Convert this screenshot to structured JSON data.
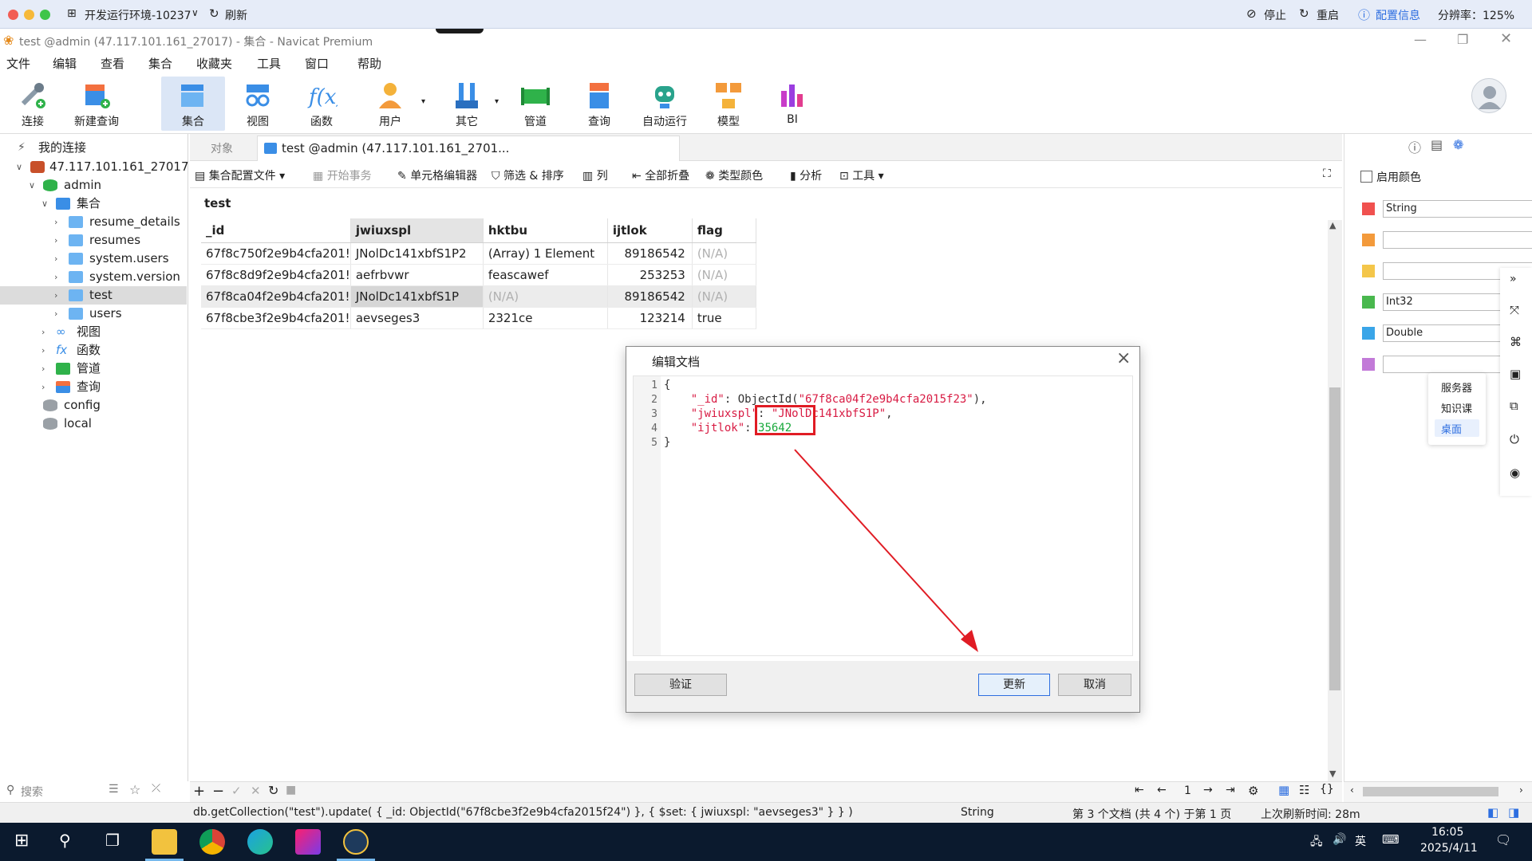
{
  "remote_bar": {
    "env_name": "开发运行环境-10237",
    "refresh": "刷新",
    "stop": "停止",
    "restart": "重启",
    "config_info": "配置信息",
    "resolution": "分辨率：125%"
  },
  "window": {
    "title": "test @admin (47.117.101.161_27017) - 集合 - Navicat Premium"
  },
  "menu": [
    "文件",
    "编辑",
    "查看",
    "集合",
    "收藏夹",
    "工具",
    "窗口",
    "帮助"
  ],
  "toolbar": [
    "连接",
    "新建查询",
    "集合",
    "视图",
    "函数",
    "用户",
    "其它",
    "管道",
    "查询",
    "自动运行",
    "模型",
    "BI"
  ],
  "tree": {
    "root": "我的连接",
    "connection": "47.117.101.161_27017",
    "db_admin": "admin",
    "collections": "集合",
    "items": [
      "resume_details",
      "resumes",
      "system.users",
      "system.version",
      "test",
      "users"
    ],
    "views": "视图",
    "functions": "函数",
    "pipelines": "管道",
    "queries": "查询",
    "db_config": "config",
    "db_local": "local",
    "search_placeholder": "搜索"
  },
  "tabs": {
    "objects": "对象",
    "active": "test @admin (47.117.101.161_2701..."
  },
  "subtoolbar": [
    "集合配置文件",
    "开始事务",
    "单元格编辑器",
    "筛选 & 排序",
    "列",
    "全部折叠",
    "类型颜色",
    "分析",
    "工具"
  ],
  "grid": {
    "collection_name": "test",
    "columns": [
      "_id",
      "jwiuxspl",
      "hktbu",
      "ijtlok",
      "flag"
    ],
    "rows": [
      [
        "67f8c750f2e9b4cfa201!",
        "JNolDc141xbfS1P2",
        "(Array) 1 Element",
        "89186542",
        "(N/A)"
      ],
      [
        "67f8c8d9f2e9b4cfa201!",
        "aefrbvwr",
        "feascawef",
        "253253",
        "(N/A)"
      ],
      [
        "67f8ca04f2e9b4cfa201!",
        "JNolDc141xbfS1P",
        "(N/A)",
        "89186542",
        "(N/A)"
      ],
      [
        "67f8cbe3f2e9b4cfa201!",
        "aevseges3",
        "2321ce",
        "123214",
        "true"
      ]
    ]
  },
  "dialog": {
    "title": "编辑文档",
    "lines": [
      "1",
      "2",
      "3",
      "4",
      "5"
    ],
    "open_brace": "{",
    "close_brace": "}",
    "id_key": "\"_id\"",
    "id_val_fn": "ObjectId(",
    "id_val": "\"67f8ca04f2e9b4cfa2015f23\"",
    "id_val_end": "),",
    "field2_key": "\"jwiuxspl\"",
    "field2_val": "\"JNolDc141xbfS1P\"",
    "field3_key": "\"ijtlok\"",
    "field3_val": "35642",
    "validate_button": "验证",
    "update_button": "更新",
    "cancel_button": "取消"
  },
  "right_panel": {
    "enable_color": "启用颜色",
    "types": [
      "String",
      "",
      "",
      "Int32",
      "Double",
      ""
    ],
    "colors": [
      "#f0514f",
      "#f39a3b",
      "#f4c64a",
      "#49b84e",
      "#3aa5e8",
      "#c27ad8"
    ]
  },
  "popup": [
    "服务器",
    "知识课",
    "桌面"
  ],
  "status": {
    "query": "db.getCollection(\"test\").update( { _id: ObjectId(\"67f8cbe3f2e9b4cfa2015f24\") }, { $set: { jwiuxspl: \"aevseges3\" } } )",
    "type": "String",
    "doc_info": "第 3 个文档 (共 4 个) 于第 1 页",
    "last_refresh": "上次刷新时间: 28m",
    "page": "1"
  },
  "taskbar": {
    "time": "16:05",
    "date": "2025/4/11",
    "ime": "英"
  }
}
